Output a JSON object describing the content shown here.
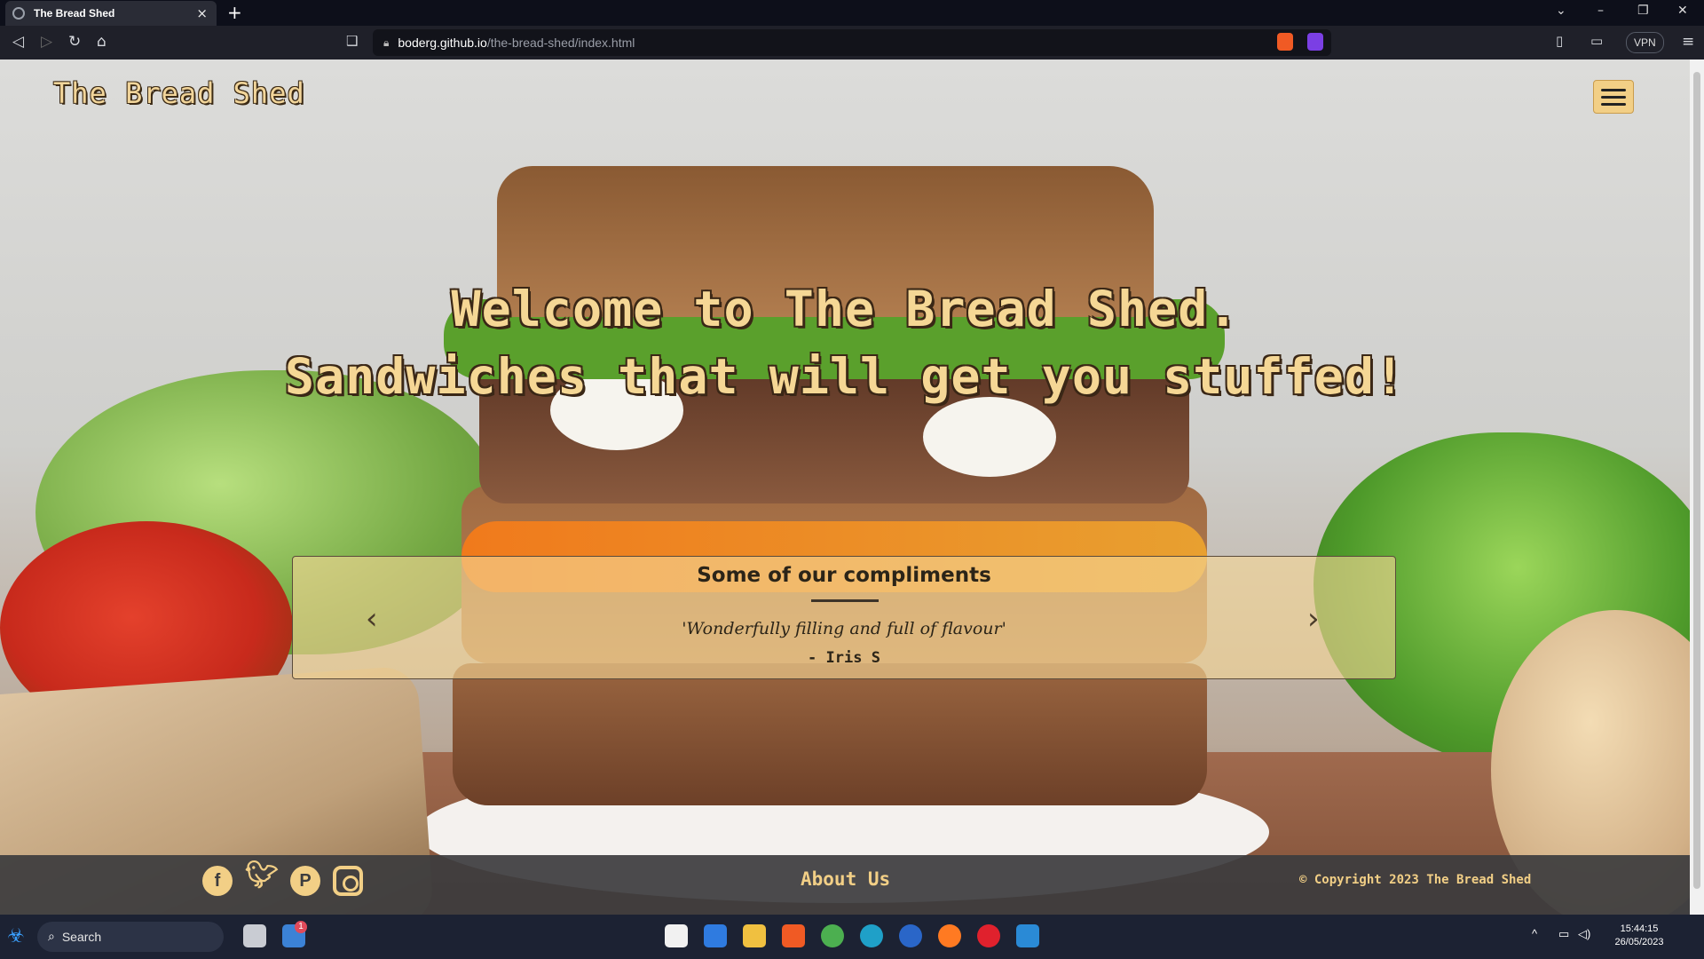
{
  "browser": {
    "tab_title": "The Bread Shed",
    "tab_close": "×",
    "new_tab": "+",
    "url_host": "boderg.github.io",
    "url_path": "/the-bread-shed/index.html",
    "vpn_label": "VPN",
    "window_controls": [
      "⌄",
      "–",
      "❐",
      "✕"
    ]
  },
  "site": {
    "logo": "The Bread Shed",
    "hero_line1": "Welcome to The Bread Shed.",
    "hero_line2": "Sandwiches that will get you stuffed!",
    "compliments": {
      "heading": "Some of our compliments",
      "quote": "'Wonderfully filling and full of flavour'",
      "author": "- Iris S",
      "prev_glyph": "‹",
      "next_glyph": "›"
    },
    "footer": {
      "social_icons": [
        "facebook-icon",
        "twitter-icon",
        "pinterest-icon",
        "instagram-icon"
      ],
      "about_label": "About Us",
      "copyright": "© Copyright 2023 The Bread Shed"
    },
    "colors": {
      "accent": "#f2cf86",
      "footer_bg": "#3c3c3e"
    }
  },
  "taskbar": {
    "search_label": "Search",
    "time": "15:44:15",
    "date": "26/05/2023",
    "notification_count": "1"
  }
}
